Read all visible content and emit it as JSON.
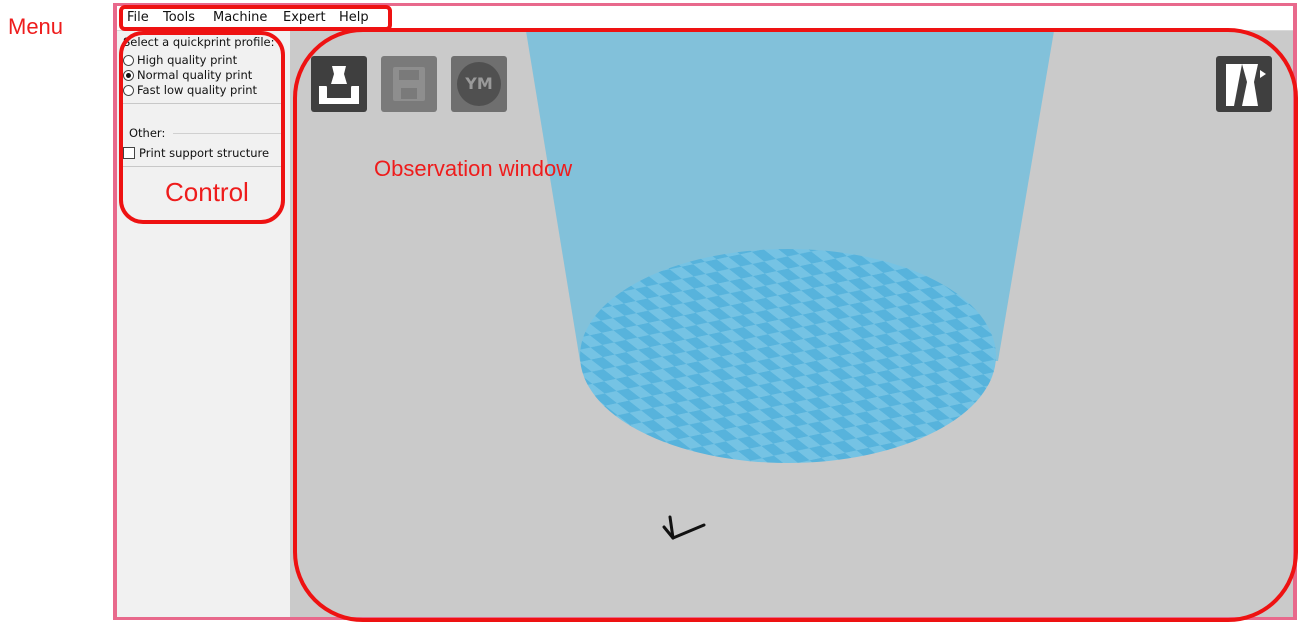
{
  "annotations": {
    "menu": "Menu",
    "control": "Control",
    "observation": "Observation window",
    "color": "#ee1c1c"
  },
  "menubar": {
    "items": [
      "File",
      "Tools",
      "Machine",
      "Expert",
      "Help"
    ]
  },
  "control_panel": {
    "title": "Select a quickprint profile:",
    "profiles": [
      {
        "label": "High quality print",
        "selected": false
      },
      {
        "label": "Normal quality print",
        "selected": true
      },
      {
        "label": "Fast low quality print",
        "selected": false
      }
    ],
    "other_label": "Other:",
    "support_label": "Print support structure",
    "support_checked": false
  },
  "toolbar": {
    "load_icon": "load-model-icon",
    "save_icon": "save-icon",
    "ym_label": "YM",
    "view_icon": "view-mode-icon"
  },
  "viewport": {
    "background": "#cacaca",
    "platform_colors": [
      "#57b3dc",
      "#75c3e4"
    ],
    "build_volume_color": "#7dc0da"
  }
}
